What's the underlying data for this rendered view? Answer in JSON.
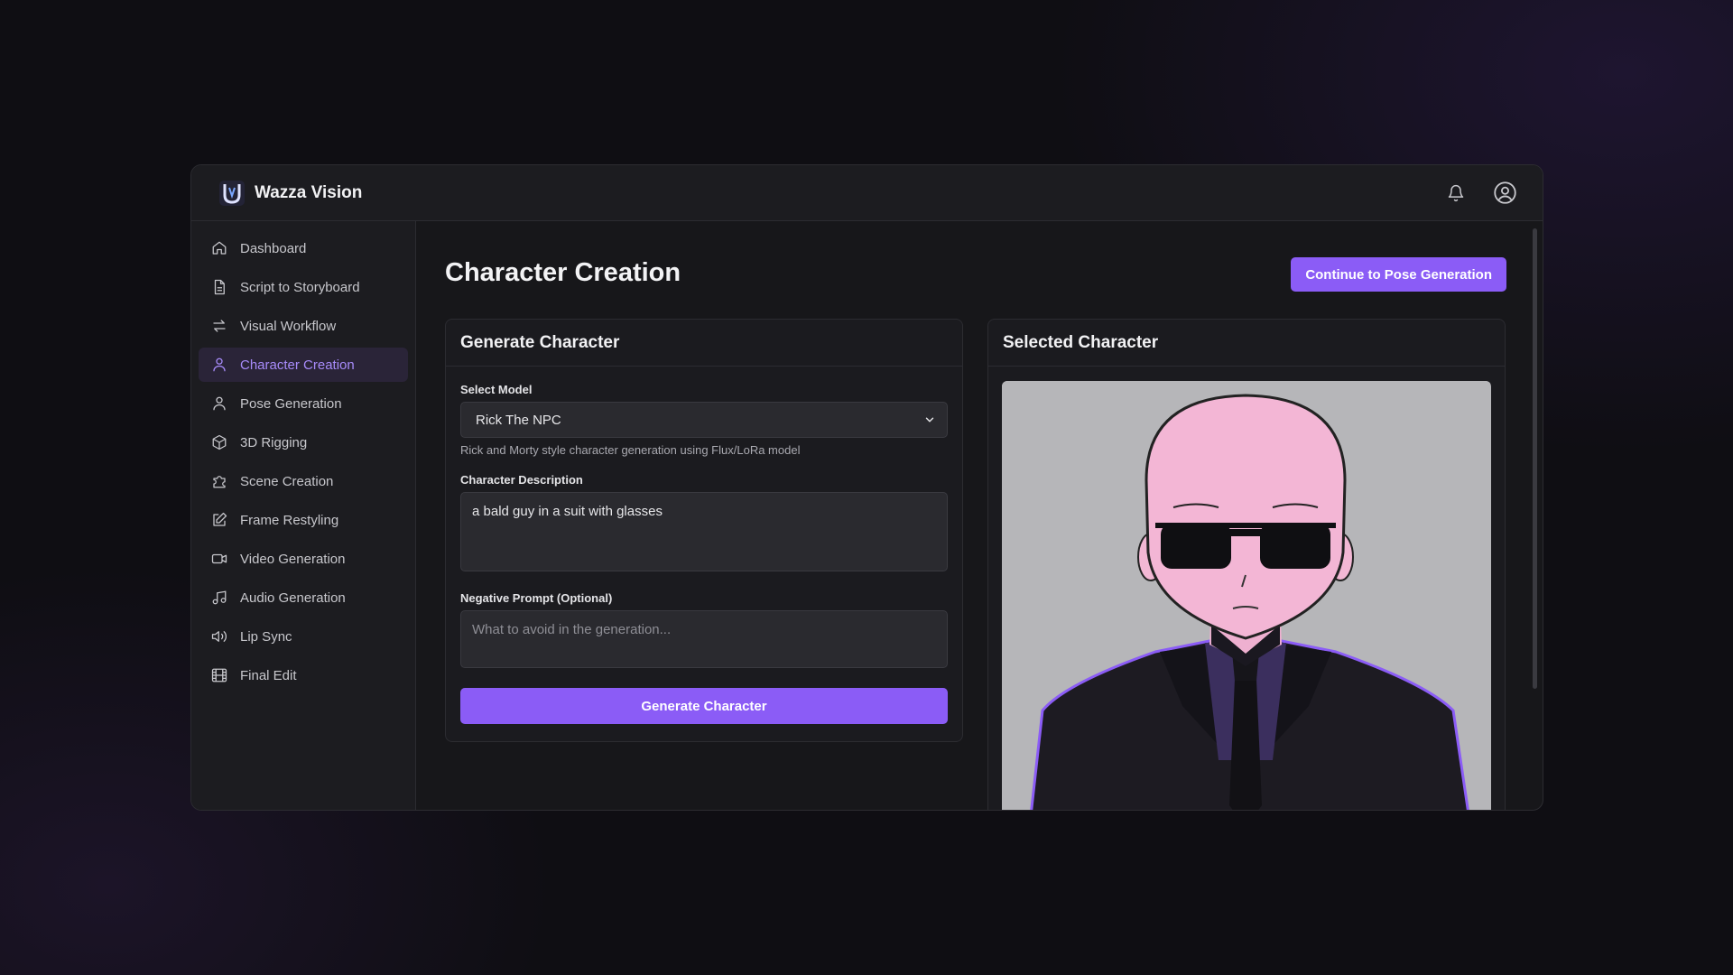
{
  "app": {
    "title": "Wazza Vision"
  },
  "sidebar": {
    "items": [
      {
        "label": "Dashboard",
        "icon": "home-icon"
      },
      {
        "label": "Script to Storyboard",
        "icon": "file-text-icon"
      },
      {
        "label": "Visual Workflow",
        "icon": "arrows-swap-icon"
      },
      {
        "label": "Character Creation",
        "icon": "user-icon",
        "active": true
      },
      {
        "label": "Pose Generation",
        "icon": "user-icon"
      },
      {
        "label": "3D Rigging",
        "icon": "cube-icon"
      },
      {
        "label": "Scene Creation",
        "icon": "puzzle-icon"
      },
      {
        "label": "Frame Restyling",
        "icon": "edit-icon"
      },
      {
        "label": "Video Generation",
        "icon": "video-icon"
      },
      {
        "label": "Audio Generation",
        "icon": "music-icon"
      },
      {
        "label": "Lip Sync",
        "icon": "speaker-icon"
      },
      {
        "label": "Final Edit",
        "icon": "film-icon"
      }
    ]
  },
  "main": {
    "title": "Character Creation",
    "continue_label": "Continue to Pose Generation",
    "generate_card": {
      "title": "Generate Character",
      "model_label": "Select Model",
      "model_value": "Rick The NPC",
      "model_help": "Rick and Morty style character generation using Flux/LoRa model",
      "description_label": "Character Description",
      "description_value": "a bald guy in a suit with glasses",
      "negative_label": "Negative Prompt (Optional)",
      "negative_placeholder": "What to avoid in the generation...",
      "generate_label": "Generate Character"
    },
    "selected_card": {
      "title": "Selected Character"
    }
  },
  "colors": {
    "accent": "#8b5cf6",
    "active_text": "#a78bfa",
    "active_bg": "#2a2438"
  }
}
